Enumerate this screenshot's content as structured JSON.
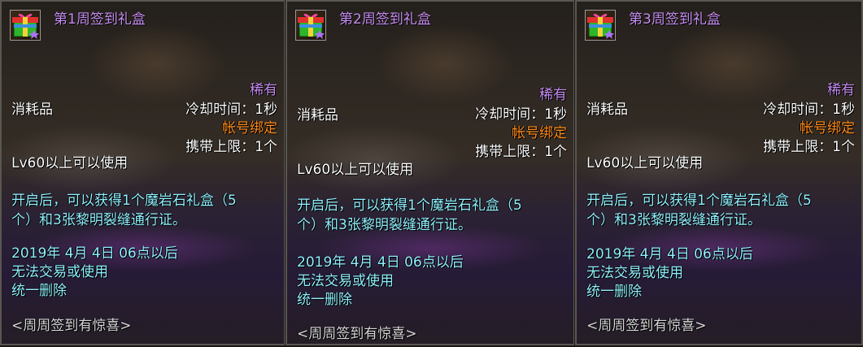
{
  "common": {
    "rarity": "稀有",
    "category": "消耗品",
    "cooldown": "冷却时间：1秒",
    "binding": "帐号绑定",
    "carry_limit": "携带上限：1个",
    "level_req": "Lv60以上可以使用",
    "desc_line1": "开启后，可以获得1个魔岩石礼盒（5",
    "desc_line2": "个）和3张黎明裂缝通行证。",
    "expiry_date": "2019年 4月 4日 06点以后",
    "expiry_line2": "无法交易或使用",
    "expiry_line3": "统一删除",
    "set_name": "<周周签到有惊喜>"
  },
  "panels": [
    {
      "title": "第1周签到礼盒"
    },
    {
      "title": "第2周签到礼盒"
    },
    {
      "title": "第3周签到礼盒"
    }
  ],
  "colors": {
    "title": "#c58cf0",
    "rarity": "#c58cf0",
    "binding": "#ff8c1a",
    "description": "#8ff0ff",
    "normal": "#ffffff"
  },
  "icons": [
    "gift-box-icon"
  ]
}
